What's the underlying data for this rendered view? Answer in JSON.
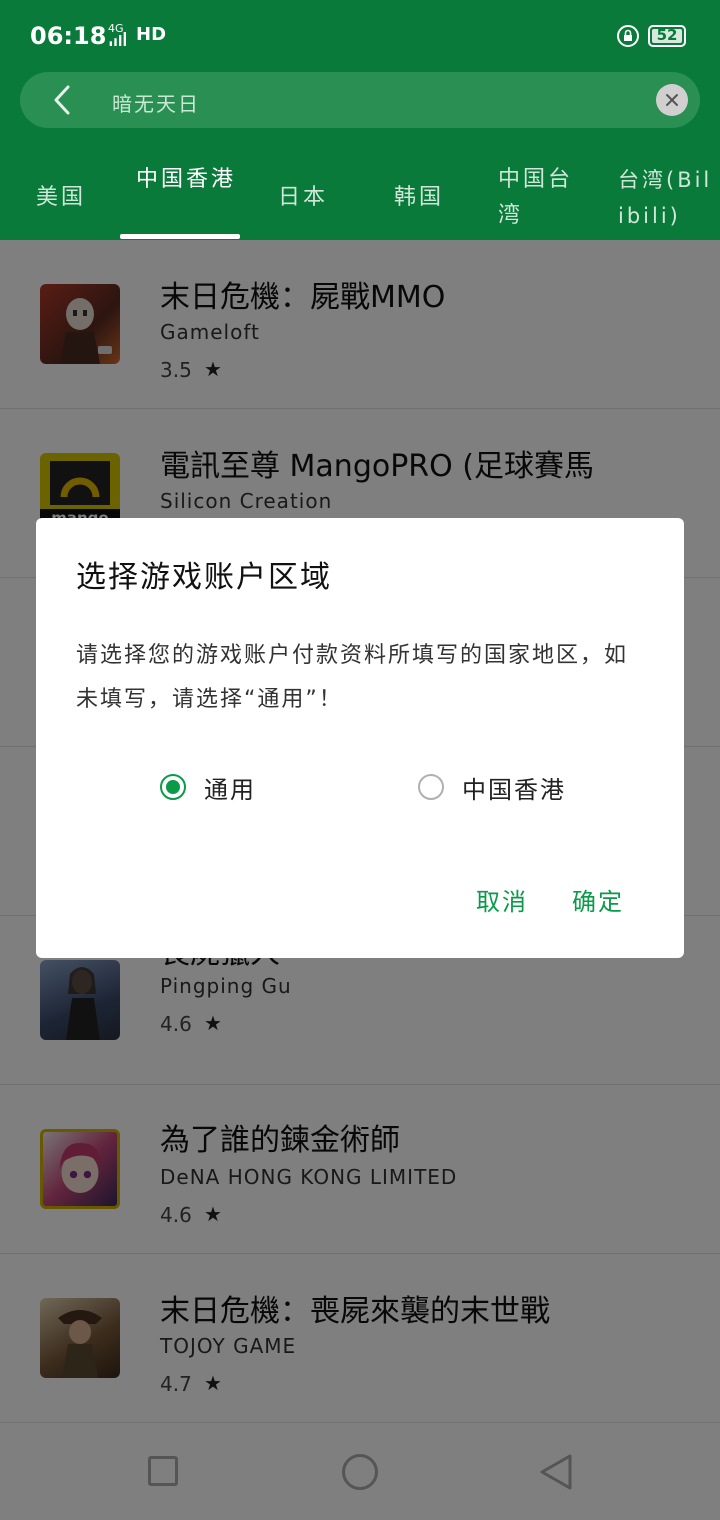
{
  "status": {
    "time": "06:18",
    "network": "4G",
    "hd": "HD",
    "battery": "52"
  },
  "search": {
    "query": "暗无天日"
  },
  "tabs": [
    {
      "label": "美国",
      "active": false
    },
    {
      "label": "中国香港",
      "active": true
    },
    {
      "label": "日本",
      "active": false
    },
    {
      "label": "韩国",
      "active": false
    },
    {
      "label": "中国台湾",
      "active": false
    },
    {
      "label": "台湾(Bilibili)",
      "active": false
    }
  ],
  "apps": [
    {
      "title": "末日危機：屍戰MMO",
      "developer": "Gameloft",
      "rating": "3.5"
    },
    {
      "title": "電訊至尊 MangoPRO (足球賽馬",
      "developer": "Silicon Creation",
      "rating": ""
    },
    {
      "title": "喪屍獵人",
      "developer": "Pingping Gu",
      "rating": "4.6"
    },
    {
      "title": "為了誰的鍊金術師",
      "developer": "DeNA HONG KONG LIMITED",
      "rating": "4.6"
    },
    {
      "title": "末日危機：喪屍來襲的末世戰",
      "developer": "TOJOY GAME",
      "rating": "4.7"
    }
  ],
  "mango_logo_text": "mango",
  "dialog": {
    "title": "选择游戏账户区域",
    "message": "请选择您的游戏账户付款资料所填写的国家地区，如未填写，请选择“通用”！",
    "options": [
      {
        "label": "通用",
        "checked": true
      },
      {
        "label": "中国香港",
        "checked": false
      }
    ],
    "cancel": "取消",
    "confirm": "确定"
  },
  "colors": {
    "header": "#0a7a3a",
    "accent": "#0a9a4a"
  },
  "icons": [
    "back-arrow-icon",
    "clear-icon",
    "star-icon",
    "radio-icon",
    "nav-square-icon",
    "nav-home-icon",
    "nav-back-icon"
  ]
}
